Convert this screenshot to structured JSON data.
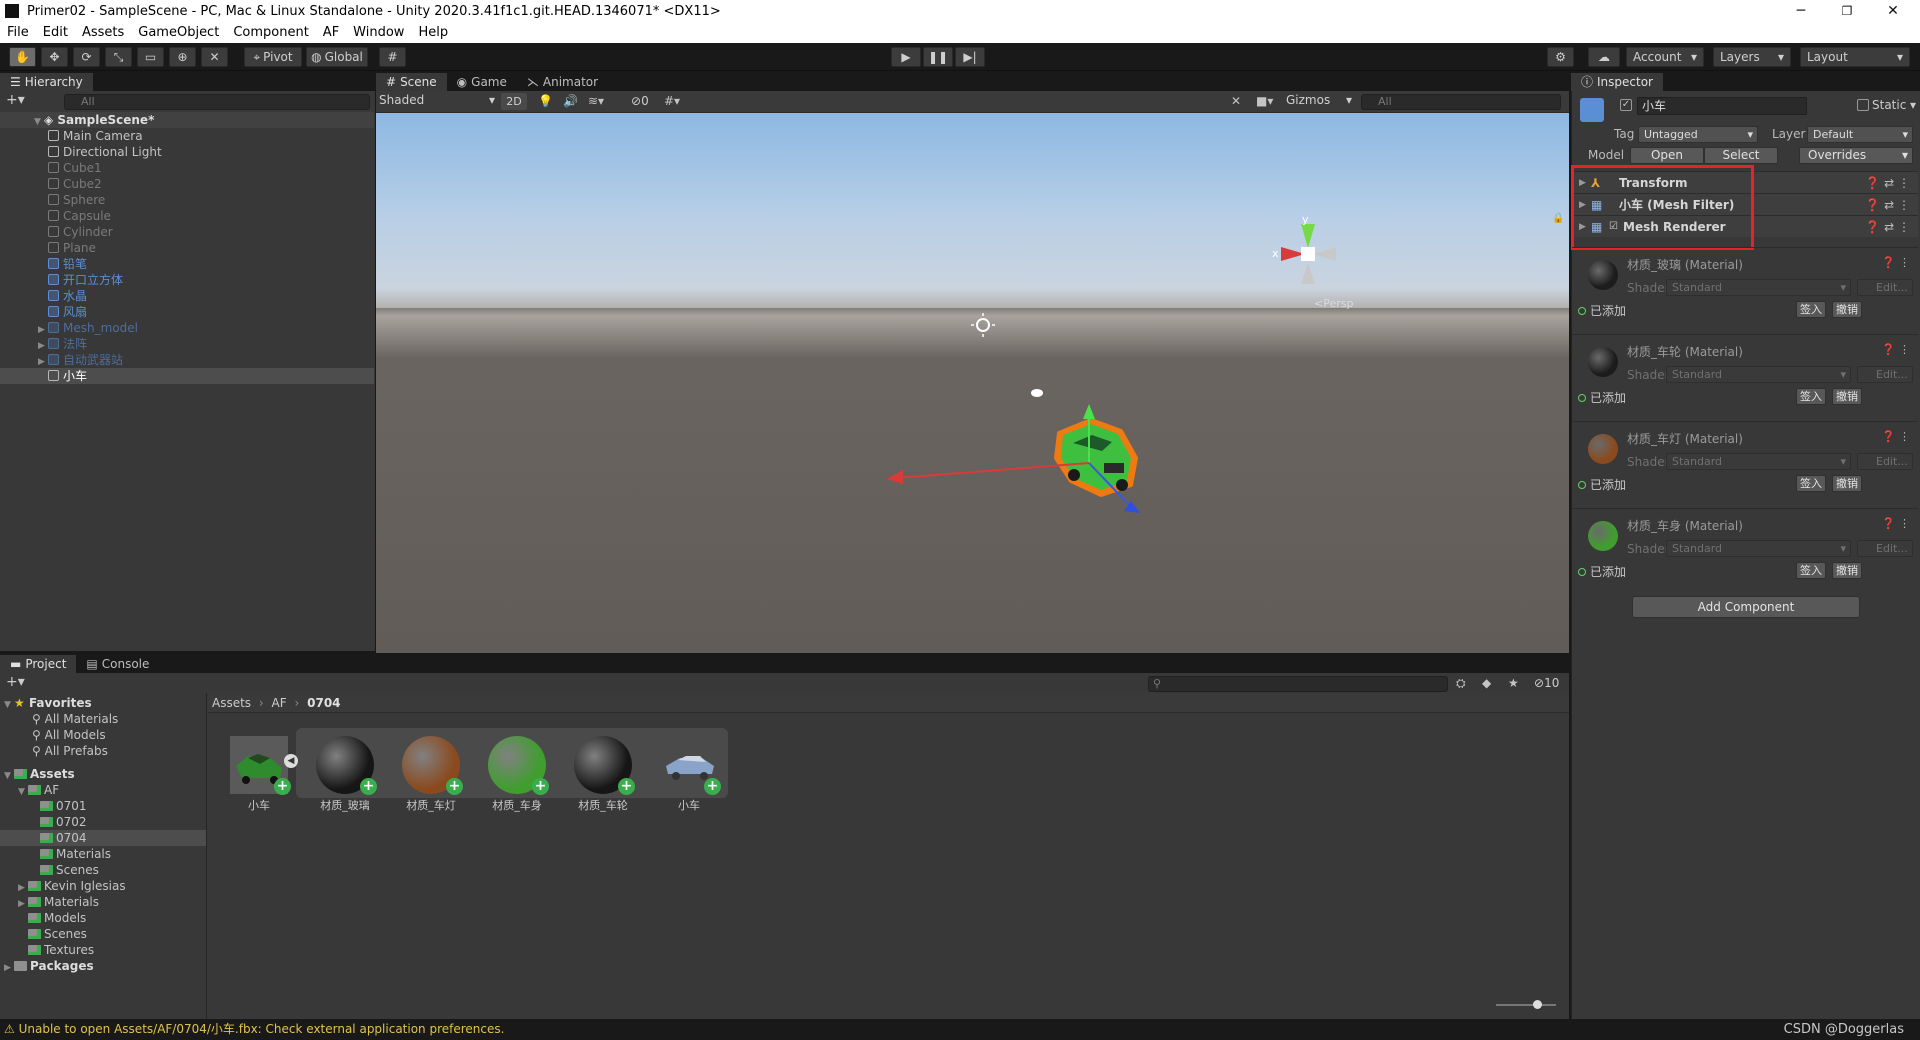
{
  "window": {
    "title": "Primer02 - SampleScene - PC, Mac & Linux Standalone - Unity 2020.3.41f1c1.git.HEAD.1346071* <DX11>",
    "minimize": "─",
    "maximize": "❐",
    "close": "✕"
  },
  "menu": [
    "File",
    "Edit",
    "Assets",
    "GameObject",
    "Component",
    "AF",
    "Window",
    "Help"
  ],
  "toolbar": {
    "pivot": "Pivot",
    "global": "Global",
    "account": "Account",
    "layers": "Layers",
    "layout": "Layout"
  },
  "hierarchy": {
    "tab": "Hierarchy",
    "search_placeholder": "All",
    "scene": "SampleScene*",
    "items": [
      {
        "label": "Main Camera",
        "style": "normal",
        "arrow": ""
      },
      {
        "label": "Directional Light",
        "style": "normal",
        "arrow": ""
      },
      {
        "label": "Cube1",
        "style": "dis",
        "arrow": ""
      },
      {
        "label": "Cube2",
        "style": "dis",
        "arrow": ""
      },
      {
        "label": "Sphere",
        "style": "dis",
        "arrow": ""
      },
      {
        "label": "Capsule",
        "style": "dis",
        "arrow": ""
      },
      {
        "label": "Cylinder",
        "style": "dis",
        "arrow": ""
      },
      {
        "label": "Plane",
        "style": "dis",
        "arrow": ""
      },
      {
        "label": "铅笔",
        "style": "pref",
        "arrow": ""
      },
      {
        "label": "开口立方体",
        "style": "pref",
        "arrow": ""
      },
      {
        "label": "水晶",
        "style": "pref",
        "arrow": ""
      },
      {
        "label": "风扇",
        "style": "pref",
        "arrow": ""
      },
      {
        "label": "Mesh_model",
        "style": "prefdis",
        "arrow": "▶"
      },
      {
        "label": "法阵",
        "style": "prefdis",
        "arrow": "▶"
      },
      {
        "label": "自动武器站",
        "style": "prefdis",
        "arrow": "▶"
      },
      {
        "label": "小车",
        "style": "sel",
        "arrow": ""
      }
    ]
  },
  "scene_tabs": {
    "scene": "Scene",
    "game": "Game",
    "animator": "Animator"
  },
  "scene_toolbar": {
    "shading": "Shaded",
    "mode_2d": "2D",
    "hidden_count": "0",
    "gizmos": "Gizmos",
    "search_placeholder": "All"
  },
  "scene_gizmo": {
    "y": "y",
    "x": "x",
    "persp": "<Persp"
  },
  "inspector": {
    "tab": "Inspector",
    "object_name": "小车",
    "static_label": "Static",
    "tag_label": "Tag",
    "tag_value": "Untagged",
    "layer_label": "Layer",
    "layer_value": "Default",
    "model_label": "Model",
    "open_btn": "Open",
    "select_btn": "Select",
    "overrides_btn": "Overrides",
    "components": [
      "Transform",
      "小车 (Mesh Filter)",
      "Mesh Renderer"
    ],
    "materials": [
      {
        "title": "材质_玻璃 (Material)",
        "color": "#1c1c1c"
      },
      {
        "title": "材质_车轮 (Material)",
        "color": "#1c1c1c"
      },
      {
        "title": "材质_车灯 (Material)",
        "color": "#8a4a1e"
      },
      {
        "title": "材质_车身 (Material)",
        "color": "#3f9e2e"
      }
    ],
    "shader_label": "Shader",
    "shader_value": "Standard",
    "edit_btn": "Edit...",
    "added_label": "已添加",
    "sign_btn": "签入",
    "revert_btn": "撤销",
    "add_component": "Add Component"
  },
  "project": {
    "tab_project": "Project",
    "tab_console": "Console",
    "favorites": "Favorites",
    "fav_items": [
      "All Materials",
      "All Models",
      "All Prefabs"
    ],
    "assets": "Assets",
    "tree": [
      {
        "label": "AF",
        "indent": 1,
        "arrow": "▼",
        "sel": false
      },
      {
        "label": "0701",
        "indent": 2,
        "arrow": "",
        "sel": false
      },
      {
        "label": "0702",
        "indent": 2,
        "arrow": "",
        "sel": false
      },
      {
        "label": "0704",
        "indent": 2,
        "arrow": "",
        "sel": true
      },
      {
        "label": "Materials",
        "indent": 2,
        "arrow": "",
        "sel": false
      },
      {
        "label": "Scenes",
        "indent": 2,
        "arrow": "",
        "sel": false
      },
      {
        "label": "Kevin Iglesias",
        "indent": 1,
        "arrow": "▶",
        "sel": false
      },
      {
        "label": "Materials",
        "indent": 1,
        "arrow": "▶",
        "sel": false
      },
      {
        "label": "Models",
        "indent": 1,
        "arrow": "",
        "sel": false
      },
      {
        "label": "Scenes",
        "indent": 1,
        "arrow": "",
        "sel": false
      },
      {
        "label": "Textures",
        "indent": 1,
        "arrow": "",
        "sel": false
      }
    ],
    "packages": "Packages",
    "breadcrumb": [
      "Assets",
      "AF",
      "0704"
    ],
    "hidden_count": "10",
    "assets_grid": [
      {
        "label": "小车",
        "kind": "car-green"
      },
      {
        "label": "材质_玻璃",
        "color": "#161616"
      },
      {
        "label": "材质_车灯",
        "color": "#8a4a1e"
      },
      {
        "label": "材质_车身",
        "color": "#3f9e2e"
      },
      {
        "label": "材质_车轮",
        "color": "#161616"
      },
      {
        "label": "小车",
        "kind": "car-blue"
      }
    ]
  },
  "status": {
    "message": "Unable to open Assets/AF/0704/小车.fbx: Check external application preferences.",
    "watermark": "CSDN @Doggerlas"
  }
}
